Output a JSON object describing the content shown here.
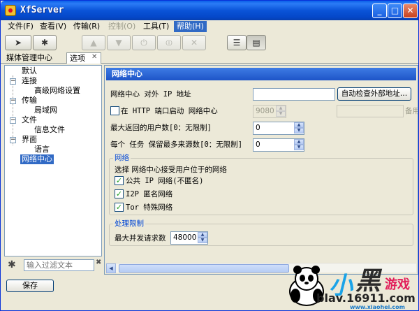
{
  "window": {
    "title": "XfServer"
  },
  "menu": {
    "items": [
      {
        "label": "文件(F)",
        "disabled": false
      },
      {
        "label": "查看(V)",
        "disabled": false
      },
      {
        "label": "传输(R)",
        "disabled": false
      },
      {
        "label": "控制(O)",
        "disabled": true
      },
      {
        "label": "工具(T)",
        "disabled": false
      },
      {
        "label": "帮助(H)",
        "active": true
      }
    ]
  },
  "tabs": {
    "first": "媒体管理中心",
    "second": "选项"
  },
  "tree": {
    "items": [
      {
        "label": "默认"
      },
      {
        "label": "连接"
      },
      {
        "label": "高级网络设置"
      },
      {
        "label": "传输"
      },
      {
        "label": "局域网"
      },
      {
        "label": "文件"
      },
      {
        "label": "信息文件"
      },
      {
        "label": "界面"
      },
      {
        "label": "语言"
      },
      {
        "label": "网络中心",
        "selected": true
      }
    ]
  },
  "filter": {
    "placeholder": "输入过滤文本"
  },
  "save_button": "保存",
  "panel": {
    "header": "网络中心",
    "external_ip_label": "网络中心 对外 IP 地址",
    "auto_detect_button": "自动检查外部地址…",
    "http_checkbox_label": "在 HTTP 端口启动 网络中心",
    "http_port_value": "9080",
    "backup_label": "备用",
    "max_users_label": "最大返回的用户数[0：无限制]",
    "max_users_value": "0",
    "max_sources_label": "每个 任务 保留最多来源数[0：无限制]",
    "max_sources_value": "0",
    "network_group": {
      "title": "网络",
      "description": "选择 网络中心接受用户位于的网络",
      "options": [
        {
          "label": "公共 IP 网络(不匿名)",
          "checked": true
        },
        {
          "label": "I2P 匿名网络",
          "checked": true
        },
        {
          "label": "Tor 特殊网络",
          "checked": true
        }
      ]
    },
    "limit_group": {
      "title": "处理限制",
      "max_concurrent_label": "最大并发请求数",
      "max_concurrent_value": "48000"
    }
  },
  "watermark": {
    "site": "blav.16911.com",
    "domain": "www.xiaohei.com"
  },
  "colors": {
    "title_bar": "#0a54d8",
    "accent": "#316ac5",
    "group_title": "#0046d5"
  }
}
